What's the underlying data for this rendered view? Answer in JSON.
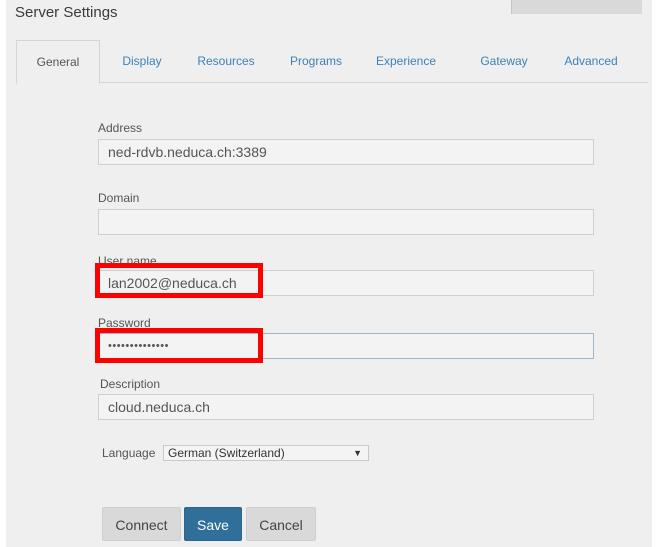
{
  "window": {
    "title": "Server Settings"
  },
  "tabs": [
    {
      "label": "General",
      "active": true
    },
    {
      "label": "Display"
    },
    {
      "label": "Resources"
    },
    {
      "label": "Programs"
    },
    {
      "label": "Experience"
    },
    {
      "label": "Gateway"
    },
    {
      "label": "Advanced"
    }
  ],
  "form": {
    "address_label": "Address",
    "address_value": "ned-rdvb.neduca.ch:3389",
    "domain_label": "Domain",
    "domain_value": "",
    "username_label": "User name",
    "username_value": "lan2002@neduca.ch",
    "password_label": "Password",
    "password_value": "••••••••••••••",
    "description_label": "Description",
    "description_value": "cloud.neduca.ch",
    "language_label": "Language",
    "language_value": "German (Switzerland)"
  },
  "buttons": {
    "connect": "Connect",
    "save": "Save",
    "cancel": "Cancel"
  },
  "colors": {
    "highlight": "#ff0000",
    "tab_link": "#3b82b8",
    "primary": "#2f6f9a"
  }
}
